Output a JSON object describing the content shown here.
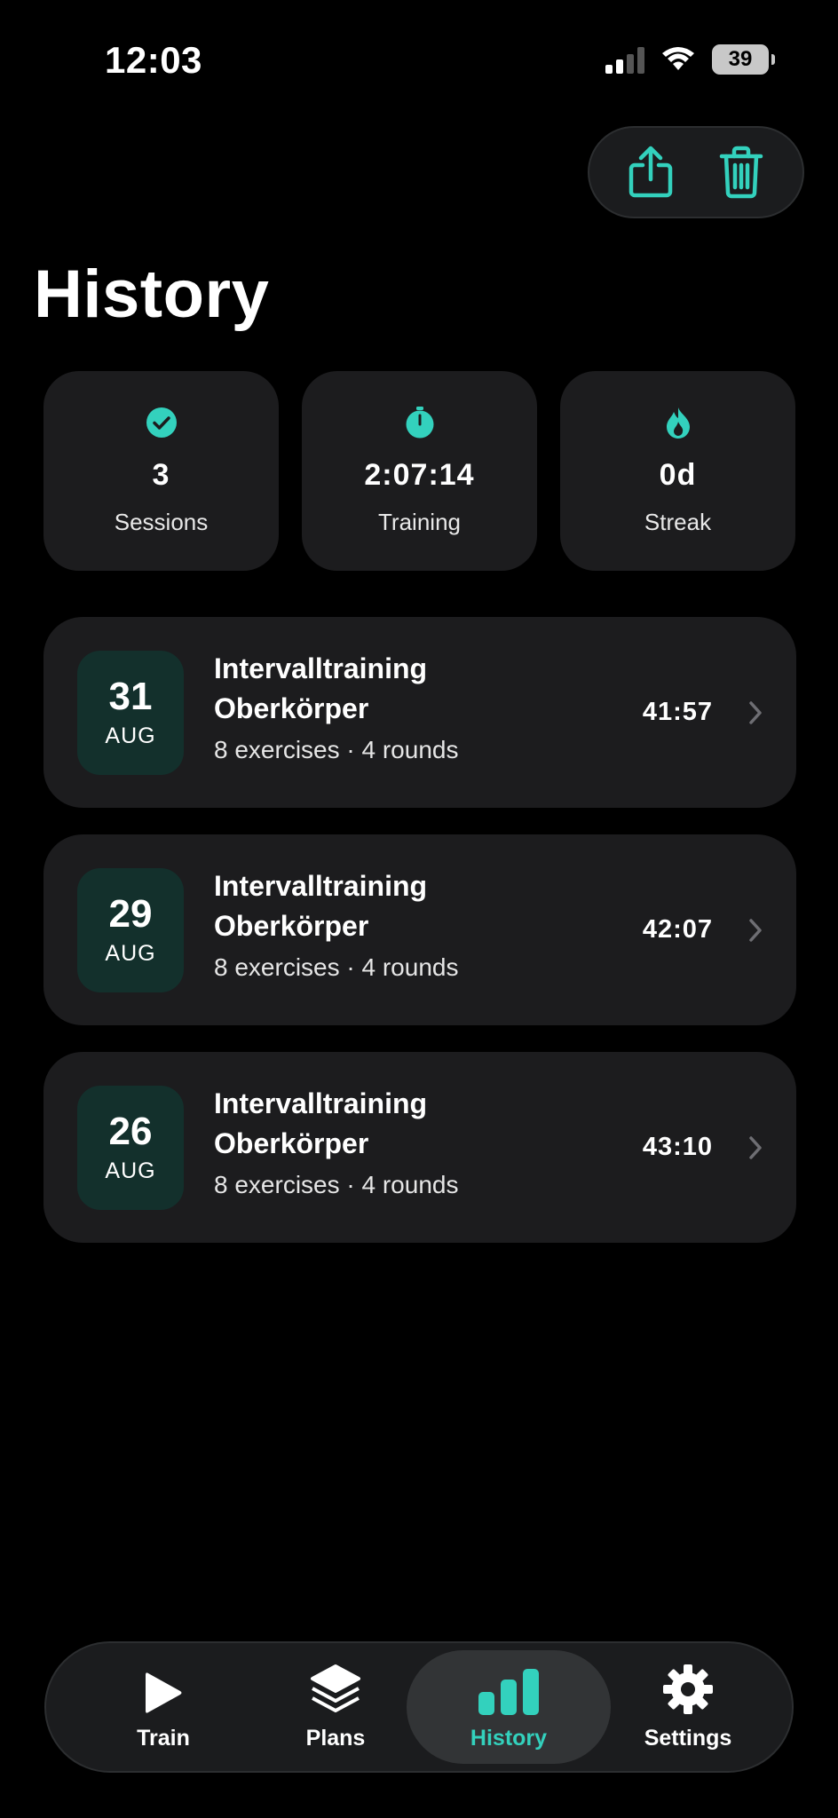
{
  "colors": {
    "accent": "#33d1bd",
    "background": "#000000",
    "card": "#1c1c1e",
    "date_badge": "#13302c"
  },
  "status_bar": {
    "time": "12:03",
    "battery": "39"
  },
  "header": {
    "title": "History",
    "share_icon": "share-icon",
    "delete_icon": "trash-icon"
  },
  "stats": [
    {
      "icon": "checkmark-circle-icon",
      "value": "3",
      "label": "Sessions"
    },
    {
      "icon": "stopwatch-icon",
      "value": "2:07:14",
      "label": "Training"
    },
    {
      "icon": "flame-icon",
      "value": "0d",
      "label": "Streak"
    }
  ],
  "sessions": [
    {
      "day": "31",
      "month": "AUG",
      "title_line1": "Intervalltraining",
      "title_line2": "Oberkörper",
      "meta": "8 exercises · 4 rounds",
      "duration": "41:57"
    },
    {
      "day": "29",
      "month": "AUG",
      "title_line1": "Intervalltraining",
      "title_line2": "Oberkörper",
      "meta": "8 exercises · 4 rounds",
      "duration": "42:07"
    },
    {
      "day": "26",
      "month": "AUG",
      "title_line1": "Intervalltraining",
      "title_line2": "Oberkörper",
      "meta": "8 exercises · 4 rounds",
      "duration": "43:10"
    }
  ],
  "tabs": [
    {
      "label": "Train",
      "icon": "play-icon",
      "active": false
    },
    {
      "label": "Plans",
      "icon": "layers-icon",
      "active": false
    },
    {
      "label": "History",
      "icon": "bar-chart-icon",
      "active": true
    },
    {
      "label": "Settings",
      "icon": "gear-icon",
      "active": false
    }
  ]
}
